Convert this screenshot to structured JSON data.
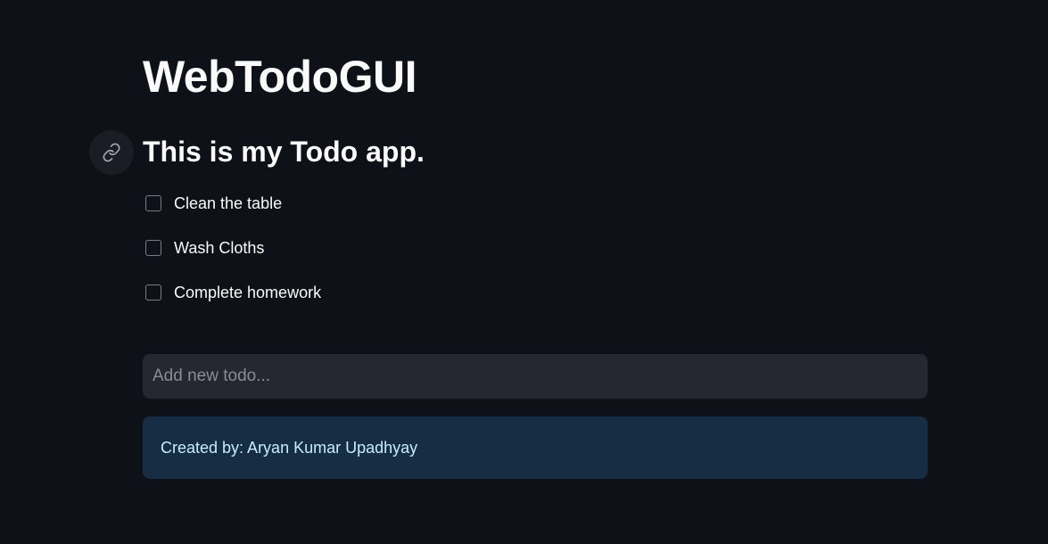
{
  "app": {
    "title": "WebTodoGUI",
    "subheader": "This is my Todo app."
  },
  "todos": [
    {
      "label": "Clean the table",
      "checked": false
    },
    {
      "label": "Wash Cloths",
      "checked": false
    },
    {
      "label": "Complete homework",
      "checked": false
    }
  ],
  "new_todo": {
    "value": "",
    "placeholder": "Add new todo..."
  },
  "footer": {
    "info_text": "Created by: Aryan Kumar Upadhyay"
  },
  "icons": {
    "anchor": "link-icon"
  },
  "colors": {
    "background": "#0e1117",
    "input_background": "#262730",
    "info_background": "#172d43",
    "info_text": "#c7ebff"
  }
}
